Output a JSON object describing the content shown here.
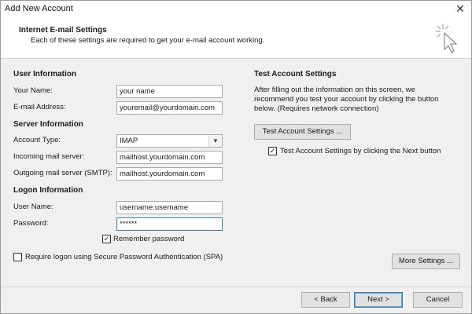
{
  "window": {
    "title": "Add New Account"
  },
  "header": {
    "title": "Internet E-mail Settings",
    "subtitle": "Each of these settings are required to get your e-mail account working."
  },
  "user_info": {
    "section": "User Information",
    "your_name_label": "Your Name:",
    "your_name_value": "your name",
    "email_label": "E-mail Address:",
    "email_value": "youremail@yourdomain.com"
  },
  "server_info": {
    "section": "Server Information",
    "account_type_label": "Account Type:",
    "account_type_value": "IMAP",
    "incoming_label": "Incoming mail server:",
    "incoming_value": "mailhost.yourdomain.com",
    "outgoing_label": "Outgoing mail server (SMTP):",
    "outgoing_value": "mailhost.yourdomain.com"
  },
  "logon_info": {
    "section": "Logon Information",
    "username_label": "User Name:",
    "username_value": "username.username",
    "password_label": "Password:",
    "password_value": "******",
    "remember_label": "Remember password",
    "remember_checked": true,
    "spa_label": "Require logon using Secure Password Authentication (SPA)",
    "spa_checked": false
  },
  "test_settings": {
    "section": "Test Account Settings",
    "description": "After filling out the information on this screen, we recommend you test your account by clicking the button below. (Requires network connection)",
    "test_button": "Test Account Settings ...",
    "next_checkbox_label": "Test Account Settings by clicking the Next button",
    "next_checkbox_checked": true
  },
  "buttons": {
    "more_settings": "More Settings ...",
    "back": "< Back",
    "next": "Next >",
    "cancel": "Cancel"
  },
  "colors": {
    "header_bg": "#ffffff",
    "body_bg": "#f0f0f0",
    "default_button_border": "#3c7fb1"
  }
}
